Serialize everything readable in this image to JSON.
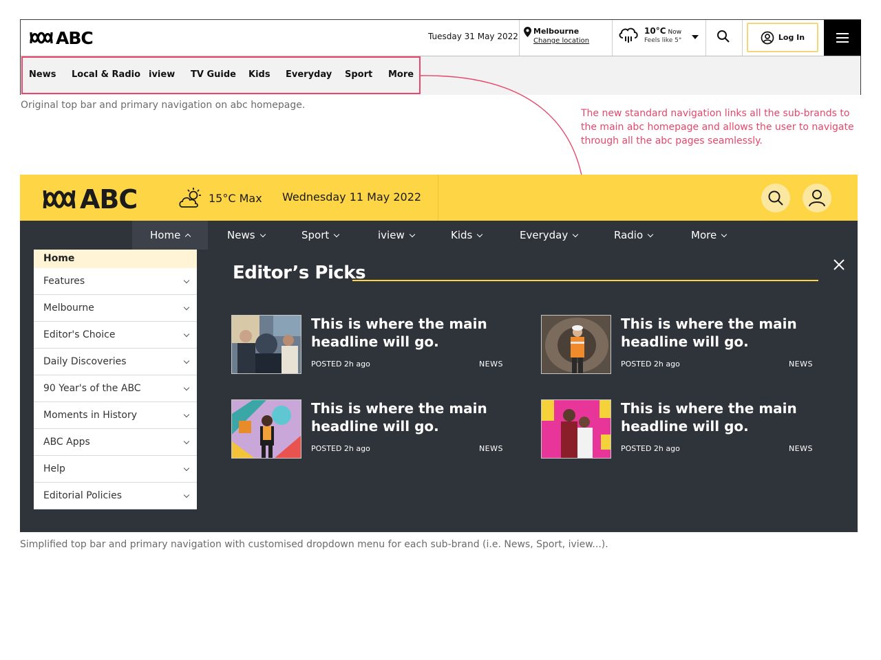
{
  "original": {
    "logo_text": "ABC",
    "date": "Tuesday 31 May 2022",
    "location": {
      "city": "Melbourne",
      "change_label": "Change location"
    },
    "weather": {
      "temp": "10°C",
      "now_label": "Now",
      "feels_like": "Feels like 5°"
    },
    "login_label": "Log In",
    "nav": [
      "News",
      "Local & Radio",
      "iview",
      "TV Guide",
      "Kids",
      "Everyday",
      "Sport",
      "More"
    ],
    "caption": "Original top bar and primary navigation on abc homepage."
  },
  "annotation": "The new standard navigation links all the sub-brands to the main abc homepage and allows the user to navigate through all the abc pages seamlessly.",
  "new_design": {
    "logo_text": "ABC",
    "weather": "15°C Max",
    "date": "Wednesday 11 May 2022",
    "nav": [
      "Home",
      "News",
      "Sport",
      "iview",
      "Kids",
      "Everyday",
      "Radio",
      "More"
    ],
    "dropdown": {
      "header": "Home",
      "items": [
        "Features",
        "Melbourne",
        "Editor's Choice",
        "Daily Discoveries",
        "90 Year's of the ABC",
        "Moments in History",
        "ABC Apps",
        "Help",
        "Editorial Policies"
      ]
    },
    "section_title": "Editor’s Picks",
    "cards": [
      {
        "headline": "This is where the main headline will go.",
        "posted": "POSTED 2h ago",
        "tag": "NEWS"
      },
      {
        "headline": "This is where the main headline will go.",
        "posted": "POSTED 2h ago",
        "tag": "NEWS"
      },
      {
        "headline": "This is where the main headline will go.",
        "posted": "POSTED 2h ago",
        "tag": "NEWS"
      },
      {
        "headline": "This is where the main headline will go.",
        "posted": "POSTED 2h ago",
        "tag": "NEWS"
      }
    ],
    "caption": "Simplified top bar and primary navigation with customised dropdown menu for each sub-brand (i.e. News, Sport, iview...)."
  },
  "colors": {
    "accent_yellow": "#fdd545",
    "dark_bg": "#2f333a",
    "annotation_red": "#e8466a"
  }
}
